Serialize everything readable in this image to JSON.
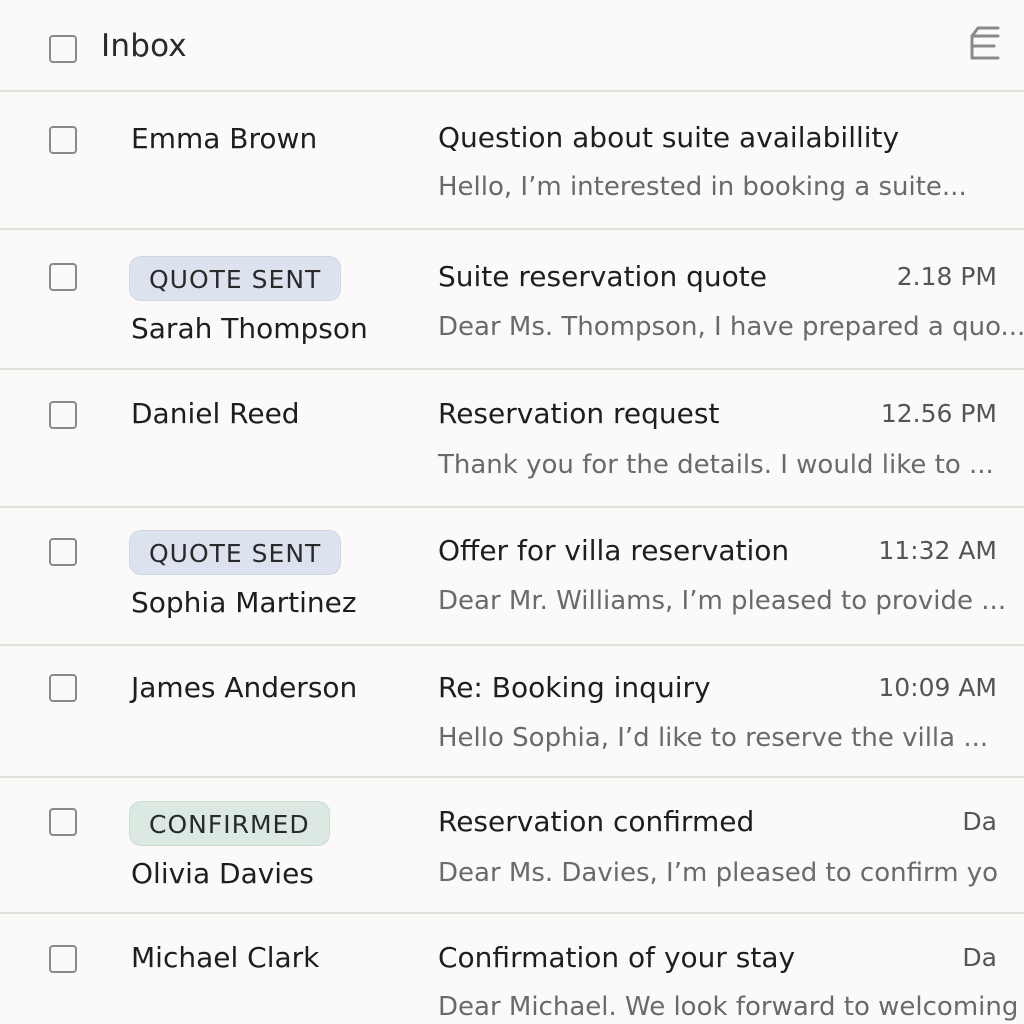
{
  "header": {
    "title": "Inbox",
    "menu_icon": "menu-icon"
  },
  "colors": {
    "background": "#fbfaf8",
    "divider": "#e3e1dd",
    "badge_quote_sent": "#dde3ee",
    "badge_confirmed": "#dbe9e2"
  },
  "emails": [
    {
      "sender": "Emma Brown",
      "badge": "",
      "subject": "Question about suite availabillity",
      "time": "",
      "snippet": "Hello, I’m interested in booking a suite..."
    },
    {
      "sender": "Sarah Thompson",
      "badge": "QUOTE SENT",
      "subject": "Suite reservation quote",
      "time": "2.18 PM",
      "snippet": "Dear Ms. Thompson, I have prepared a quo..."
    },
    {
      "sender": "Daniel Reed",
      "badge": "",
      "subject": "Reservation request",
      "time": "12.56 PM",
      "snippet": "Thank you for the details. I would like to  ..."
    },
    {
      "sender": "Sophia Martinez",
      "badge": "QUOTE SENT",
      "subject": "Offer for villa reservation",
      "time": "11:32 AM",
      "snippet": "Dear Mr. Williams, I’m pleased to provide  ..."
    },
    {
      "sender": "James Anderson",
      "badge": "",
      "subject": "Re: Booking inquiry",
      "time": "10:09 AM",
      "snippet": "Hello Sophia, I’d like to reserve the villa  ..."
    },
    {
      "sender": "Olivia Davies",
      "badge": "CONFIRMED",
      "subject": "Reservation confirmed",
      "time": "Da",
      "snippet": "Dear Ms. Davies, I’m pleased to confirm yo"
    },
    {
      "sender": "Michael Clark",
      "badge": "",
      "subject": "Confirmation of your stay",
      "time": "Da",
      "snippet": "Dear Michael. We look forward to welcoming"
    }
  ]
}
